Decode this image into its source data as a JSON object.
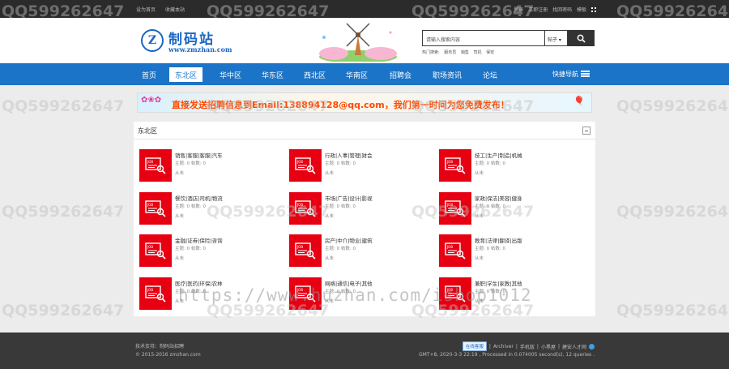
{
  "topbar": {
    "left_links": [
      "设为首页",
      "收藏本站"
    ],
    "right_links": [
      "登录",
      "立即注册",
      "找回密码",
      "模板"
    ]
  },
  "header": {
    "logo_badge": "Z",
    "logo_title": "制码站",
    "logo_url": "www.zmzhan.com",
    "search_placeholder": "请输入搜索内容",
    "search_scope": "帖子",
    "hot_label": "热门搜索:",
    "hot_terms": [
      "服务员",
      "销售",
      "司机",
      "保安"
    ]
  },
  "nav": {
    "items": [
      "首页",
      "东北区",
      "华中区",
      "华东区",
      "西北区",
      "华南区",
      "招聘会",
      "职场资讯",
      "论坛"
    ],
    "active": "东北区",
    "quick_nav": "快捷导航"
  },
  "banner": {
    "text": "直接发送招聘信息到Email:138894128@qq.com，我们第一时间为您免费发布！"
  },
  "panel": {
    "title": "东北区",
    "forums": [
      {
        "name": "销售|客服|客服|汽车",
        "stats": "主题: 0    帖数: 0",
        "last": "从未"
      },
      {
        "name": "行政|人事|管理|财会",
        "stats": "主题: 0    帖数: 0",
        "last": "从未"
      },
      {
        "name": "技工|生产|制造|机械",
        "stats": "主题: 0    帖数: 0",
        "last": "从未"
      },
      {
        "name": "餐饮|酒店|司机|物流",
        "stats": "主题: 0    帖数: 0",
        "last": "从未"
      },
      {
        "name": "市场|广告|设计|影视",
        "stats": "主题: 0    帖数: 0",
        "last": "从未"
      },
      {
        "name": "家政|保洁|美容|健身",
        "stats": "主题: 0    帖数: 0",
        "last": "从未"
      },
      {
        "name": "金融|证券|保险|咨询",
        "stats": "主题: 0    帖数: 0",
        "last": "从未"
      },
      {
        "name": "房产|中介|物业|建筑",
        "stats": "主题: 0    帖数: 0",
        "last": "从未"
      },
      {
        "name": "教育|法律|翻译|出版",
        "stats": "主题: 0    帖数: 0",
        "last": "从未"
      },
      {
        "name": "医疗|医药|环保|农林",
        "stats": "主题: 0    帖数: 0",
        "last": "从未"
      },
      {
        "name": "网络|通信|电子|其他",
        "stats": "主题: 0    帖数: 0",
        "last": "从未"
      },
      {
        "name": "兼职|学生|家教|其他",
        "stats": "主题: 0    帖数: 0",
        "last": "从未"
      }
    ]
  },
  "footer": {
    "tech": "技术支持：制码站招聘",
    "copyright": "© 2015-2016 zmzhan.com",
    "online_badge": "在线客服",
    "links": [
      "Archiver",
      "手机版",
      "小黑屋",
      "建安人才网"
    ],
    "time": "GMT+8, 2020-3-3 22:19 , Processed in 0.074005 second(s), 12 queries ."
  },
  "watermark": {
    "qq": "QQ599262647",
    "url": "https://www.huzhan.com/ishop1012"
  },
  "colors": {
    "nav_blue": "#1b74c7",
    "brand_red": "#e60012",
    "banner_orange": "#ff4a00"
  }
}
